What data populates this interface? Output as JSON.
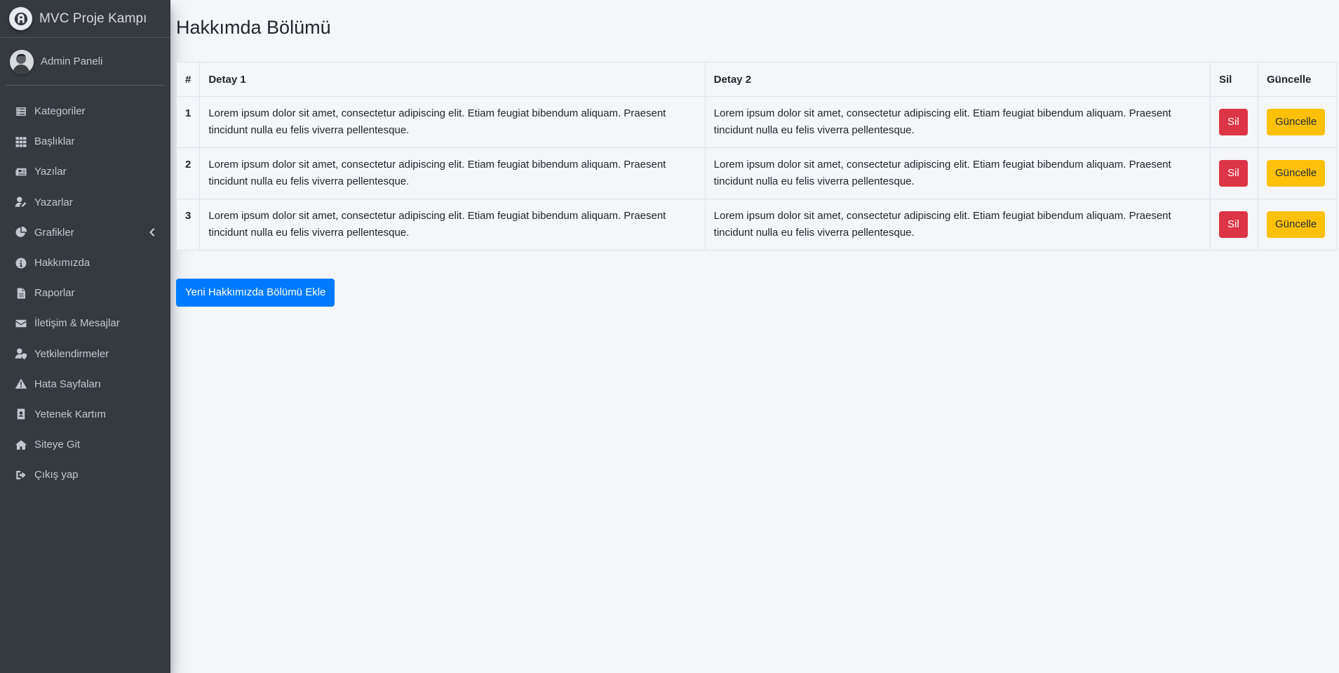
{
  "brand": {
    "title": "MVC Proje Kampı"
  },
  "user": {
    "name": "Admin Paneli"
  },
  "sidebar": {
    "items": [
      {
        "label": "Kategoriler",
        "icon": "list-icon"
      },
      {
        "label": "Başlıklar",
        "icon": "grid-icon"
      },
      {
        "label": "Yazılar",
        "icon": "newspaper-icon"
      },
      {
        "label": "Yazarlar",
        "icon": "user-edit-icon"
      },
      {
        "label": "Grafikler",
        "icon": "pie-chart-icon",
        "has_arrow": true
      },
      {
        "label": "Hakkımızda",
        "icon": "info-icon"
      },
      {
        "label": "Raporlar",
        "icon": "file-icon"
      },
      {
        "label": "İletişim & Mesajlar",
        "icon": "envelope-icon"
      },
      {
        "label": "Yetkilendirmeler",
        "icon": "user-shield-icon"
      },
      {
        "label": "Hata Sayfaları",
        "icon": "warning-icon"
      },
      {
        "label": "Yetenek Kartım",
        "icon": "id-badge-icon"
      },
      {
        "label": "Siteye Git",
        "icon": "home-icon"
      },
      {
        "label": "Çıkış yap",
        "icon": "sign-out-icon"
      }
    ]
  },
  "page": {
    "title": "Hakkımda Bölümü"
  },
  "table": {
    "headers": [
      "#",
      "Detay 1",
      "Detay 2",
      "Sil",
      "Güncelle"
    ],
    "rows": [
      {
        "id": "1",
        "detail1": "Lorem ipsum dolor sit amet, consectetur adipiscing elit. Etiam feugiat bibendum aliquam. Praesent tincidunt nulla eu felis viverra pellentesque.",
        "detail2": "Lorem ipsum dolor sit amet, consectetur adipiscing elit. Etiam feugiat bibendum aliquam. Praesent tincidunt nulla eu felis viverra pellentesque.",
        "delete_label": "Sil",
        "update_label": "Güncelle"
      },
      {
        "id": "2",
        "detail1": "Lorem ipsum dolor sit amet, consectetur adipiscing elit. Etiam feugiat bibendum aliquam. Praesent tincidunt nulla eu felis viverra pellentesque.",
        "detail2": "Lorem ipsum dolor sit amet, consectetur adipiscing elit. Etiam feugiat bibendum aliquam. Praesent tincidunt nulla eu felis viverra pellentesque.",
        "delete_label": "Sil",
        "update_label": "Güncelle"
      },
      {
        "id": "3",
        "detail1": "Lorem ipsum dolor sit amet, consectetur adipiscing elit. Etiam feugiat bibendum aliquam. Praesent tincidunt nulla eu felis viverra pellentesque.",
        "detail2": "Lorem ipsum dolor sit amet, consectetur adipiscing elit. Etiam feugiat bibendum aliquam. Praesent tincidunt nulla eu felis viverra pellentesque.",
        "delete_label": "Sil",
        "update_label": "Güncelle"
      }
    ]
  },
  "actions": {
    "add_label": "Yeni Hakkımızda Bölümü Ekle"
  },
  "colors": {
    "sidebar_bg": "#343a40",
    "danger": "#dc3545",
    "warning": "#ffc107",
    "primary": "#007bff",
    "content_bg": "#f4f6f9"
  }
}
